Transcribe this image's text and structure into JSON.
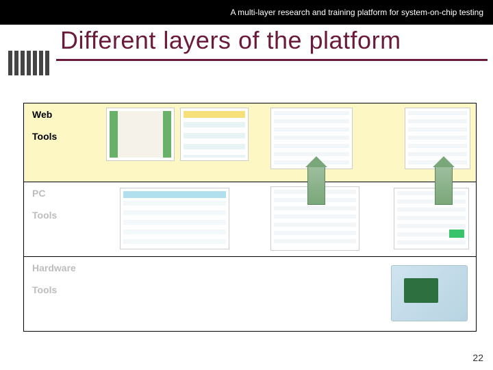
{
  "topbar": {
    "subtitle": "A multi-layer research and training platform for system-on-chip testing"
  },
  "title": "Different layers of the platform",
  "layers": {
    "web": {
      "line1": "Web",
      "line2": "Tools"
    },
    "pc": {
      "line1": "PC",
      "line2": "Tools"
    },
    "hardware": {
      "line1": "Hardware",
      "line2": "Tools"
    }
  },
  "page_number": "22"
}
